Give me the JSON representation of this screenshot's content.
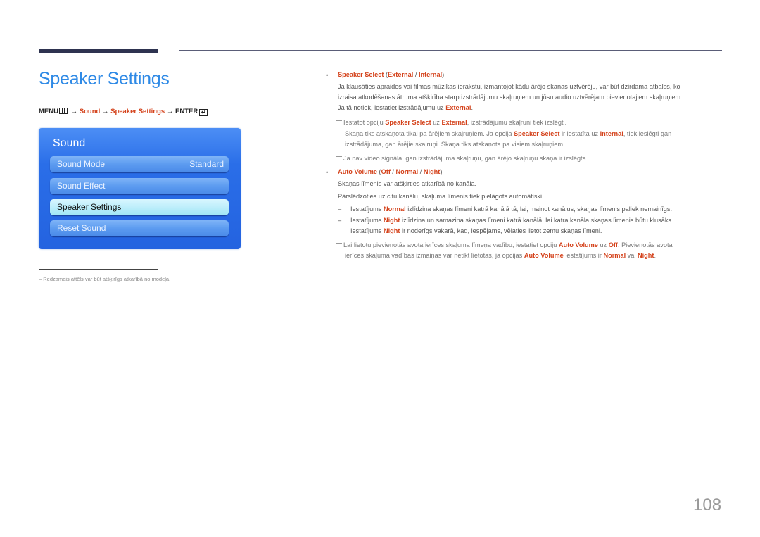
{
  "page": {
    "title": "Speaker Settings",
    "number": "108"
  },
  "menu_path": {
    "menu": "MENU",
    "arrow": "→",
    "sound": "Sound",
    "speaker_settings": "Speaker Settings",
    "enter": "ENTER",
    "enter_glyph": "↵"
  },
  "osd": {
    "title": "Sound",
    "items": [
      {
        "label": "Sound Mode",
        "value": "Standard"
      },
      {
        "label": "Sound Effect",
        "value": ""
      },
      {
        "label": "Speaker Settings",
        "value": "",
        "selected": true
      },
      {
        "label": "Reset Sound",
        "value": ""
      }
    ]
  },
  "footnote": "– Redzamais attēls var būt atšķirīgs atkarībā no modeļa.",
  "speaker_select": {
    "name": "Speaker Select",
    "opt1": "External",
    "opt2": "Internal",
    "lp": " (",
    "sep": " / ",
    "rp": ")",
    "p1": "Ja klausāties apraides vai filmas mūzikas ierakstu, izmantojot kādu ārējo skaņas uztvērēju, var būt dzirdama atbalss, ko",
    "p2": "izraisa atkodēšanas ātruma atšķirība starp izstrādājumu skaļruņiem un jūsu audio uztvērējam pievienotajiem skaļruņiem.",
    "p3a": "Ja tā notiek, iestatiet izstrādājumu uz ",
    "p3b": "External",
    "p3c": ".",
    "note1a": "Iestatot opciju ",
    "note1b": "Speaker Select",
    "note1c": " uz ",
    "note1d": "External",
    "note1e": ", izstrādājumu skaļruņi tiek izslēgti.",
    "note2a": "Skaņa tiks atskaņota tikai pa ārējiem skaļruņiem. Ja opcija ",
    "note2b": "Speaker Select",
    "note2c": " ir iestatīta uz ",
    "note2d": "Internal",
    "note2e": ", tiek ieslēgti gan",
    "note3": "izstrādājuma, gan ārējie skaļruņi. Skaņa tiks atskaņota pa visiem skaļruņiem.",
    "note4": "Ja nav video signāla, gan izstrādājuma skaļruņu, gan ārējo skaļruņu skaņa ir izslēgta."
  },
  "auto_volume": {
    "name": "Auto Volume",
    "opt1": "Off",
    "opt2": "Normal",
    "opt3": "Night",
    "lp": " (",
    "sep": " / ",
    "rp": ")",
    "p1": "Skaņas līmenis var atšķirties atkarībā no kanāla.",
    "p2": "Pārslēdzoties uz citu kanālu, skaļuma līmenis tiek pielāgots automātiski.",
    "dash": "–",
    "d1a": "Iestatījums ",
    "d1b": "Normal",
    "d1c": " izlīdzina skaņas līmeni katrā kanālā tā, lai, mainot kanālus, skaņas līmenis paliek nemainīgs.",
    "d2a": "Iestatījums ",
    "d2b": "Night",
    "d2c": " izlīdzina un samazina skaņas līmeni katrā kanālā, lai katra kanāla skaņas līmenis būtu klusāks.",
    "d3a": "Iestatījums ",
    "d3b": "Night",
    "d3c": " ir noderīgs vakarā, kad, iespējams, vēlaties lietot zemu skaņas līmeni.",
    "n1a": "Lai lietotu pievienotās avota ierīces skaļuma līmeņa vadību, iestatiet opciju ",
    "n1b": "Auto Volume",
    "n1c": " uz ",
    "n1d": "Off",
    "n1e": ". Pievienotās avota",
    "n2a": "ierīces skaļuma vadības izmaiņas var netikt lietotas, ja opcijas ",
    "n2b": "Auto Volume",
    "n2c": " iestatījums ir ",
    "n2d": "Normal",
    "n2e": " vai ",
    "n2f": "Night",
    "n2g": "."
  },
  "bullet": "•"
}
